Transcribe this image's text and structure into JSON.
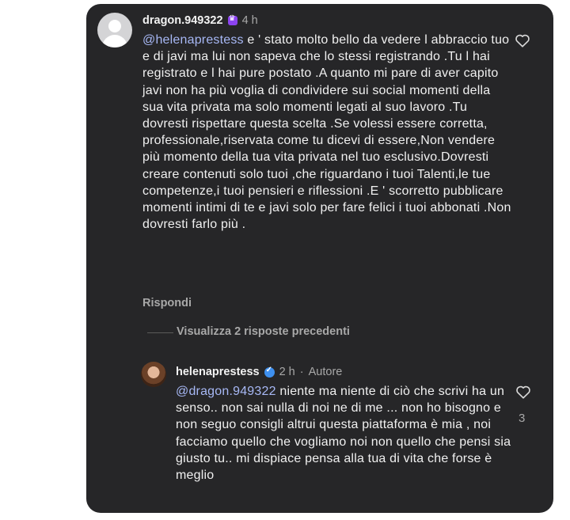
{
  "comment": {
    "username": "dragon.949322",
    "time": "4 h",
    "mention": "@helenaprestess",
    "text": " e ' stato molto bello da vedere l abbraccio tuo e di javi ma lui non sapeva che lo stessi registrando .Tu l hai registrato e l hai pure postato .A quanto mi pare di aver capito javi non ha più voglia di condividere sui social momenti della sua vita privata ma solo momenti legati al suo lavoro .Tu  dovresti rispettare questa scelta .Se volessi essere corretta, professionale,riservata come tu dicevi di essere,Non vendere più momento della tua vita privata nel tuo esclusivo.Dovresti creare contenuti solo tuoi ,che riguardano i tuoi Talenti,le tue competenze,i tuoi pensieri e riflessioni .E ' scorretto pubblicare momenti intimi di te e javi solo per fare felici i tuoi abbonati .Non dovresti farlo più .",
    "reply_label": "Rispondi",
    "view_replies": "Visualizza 2 risposte precedenti"
  },
  "reply": {
    "username": "helenaprestess",
    "time": "2 h",
    "separator": "·",
    "author_tag": "Autore",
    "mention": "@dragon.949322",
    "text": " niente ma niente di ciò che scrivi ha un senso.. non sai nulla di noi ne di me ... non ho bisogno e non seguo consigli altrui questa piattaforma è mia , noi facciamo quello che vogliamo noi non quello che pensi sia giusto tu.. mi dispiace  pensa alla tua di vita che forse è meglio",
    "likes": "3"
  },
  "icons": {
    "badge": "crown-badge-icon",
    "verified": "verified-badge-icon",
    "like": "heart-outline-icon"
  },
  "colors": {
    "card_bg": "#262628",
    "mention": "#a7b8f5",
    "secondary_text": "#a8a8a8",
    "badge": "#8c43f0",
    "verified": "#3e90f0"
  }
}
